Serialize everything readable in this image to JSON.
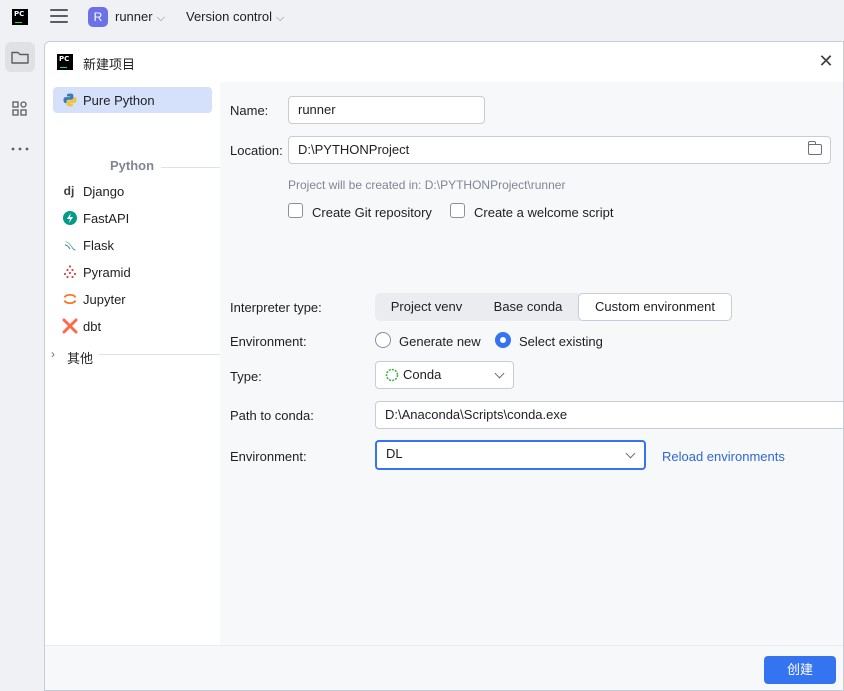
{
  "topbar": {
    "logo_text": "PC",
    "project_initial": "R",
    "project_name": "runner",
    "vcs_label": "Version control"
  },
  "dialog": {
    "title": "新建项目",
    "logo_text": "PC"
  },
  "sidebar": {
    "items": [
      {
        "label": "Pure Python",
        "icon": "python-icon",
        "selected": true
      },
      {
        "label": "Django",
        "icon": "django-icon"
      },
      {
        "label": "FastAPI",
        "icon": "fastapi-icon"
      },
      {
        "label": "Flask",
        "icon": "flask-icon"
      },
      {
        "label": "Pyramid",
        "icon": "pyramid-icon"
      },
      {
        "label": "Jupyter",
        "icon": "jupyter-icon"
      },
      {
        "label": "dbt",
        "icon": "dbt-icon"
      }
    ],
    "group_label": "Python",
    "other_label": "其他",
    "django_glyph": "dj"
  },
  "form": {
    "name_label": "Name:",
    "name_value": "runner",
    "location_label": "Location:",
    "location_value": "D:\\PYTHONProject",
    "location_hint": "Project will be created in: D:\\PYTHONProject\\runner",
    "git_label": "Create Git repository",
    "welcome_label": "Create a welcome script",
    "interpreter_label": "Interpreter type:",
    "interpreter_tabs": [
      "Project venv",
      "Base conda",
      "Custom environment"
    ],
    "interpreter_selected": "Custom environment",
    "env_mode_label": "Environment:",
    "env_generate": "Generate new",
    "env_select": "Select existing",
    "type_label": "Type:",
    "type_value": "Conda",
    "conda_path_label": "Path to conda:",
    "conda_path_value": "D:\\Anaconda\\Scripts\\conda.exe",
    "environment_label": "Environment:",
    "environment_value": "DL",
    "reload_label": "Reload environments"
  },
  "footer": {
    "create_label": "创建"
  },
  "colors": {
    "accent": "#3574f0",
    "selection": "#d5e1fb",
    "link": "#2f67d6",
    "avatar": "#6b71e6"
  }
}
